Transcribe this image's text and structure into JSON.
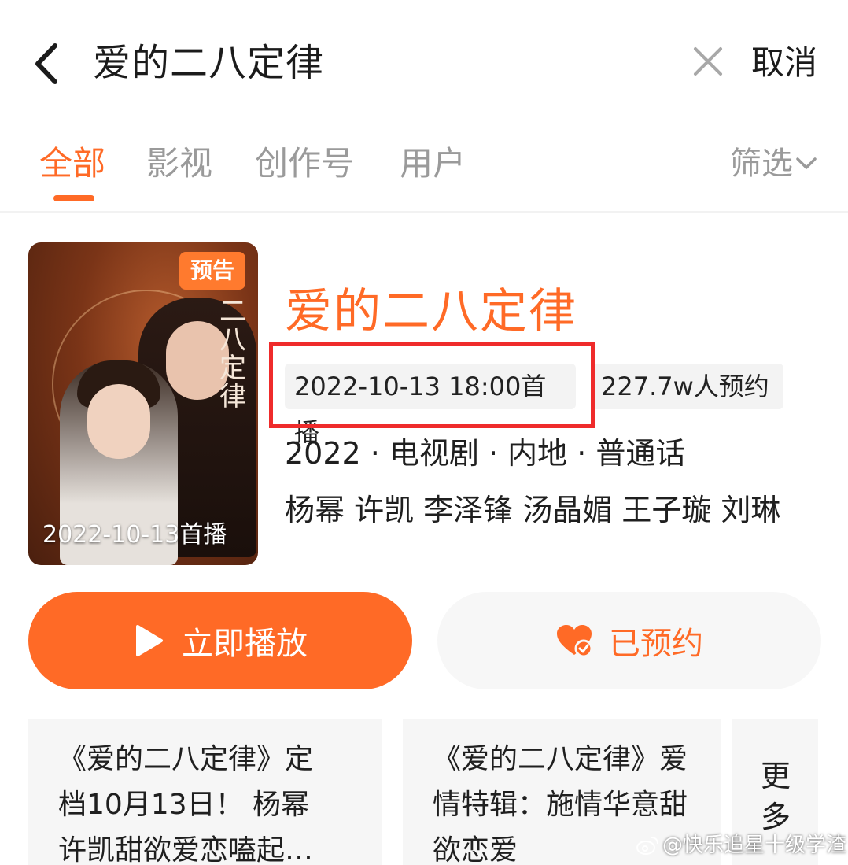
{
  "search": {
    "query": "爱的二八定律",
    "cancel_label": "取消"
  },
  "tabs": [
    {
      "label": "全部",
      "active": true
    },
    {
      "label": "影视",
      "active": false
    },
    {
      "label": "创作号",
      "active": false
    },
    {
      "label": "用户",
      "active": false
    }
  ],
  "filter_label": "筛选",
  "result": {
    "poster": {
      "badge": "预告",
      "date_text": "2022-10-13首播",
      "calligraphy_title": "二八定律"
    },
    "title": "爱的二八定律",
    "premiere": "2022-10-13 18:00首播",
    "reservations": "227.7w人预约",
    "meta": "2022 · 电视剧 · 内地 · 普通话",
    "cast": "杨幂 许凯 李泽锋 汤晶媚 王子璇 刘琳",
    "play_label": "立即播放",
    "reserved_label": "已预约"
  },
  "related": [
    {
      "lines": [
        "《爱的二八定律》定",
        "档10月13日！ 杨幂",
        "许凯甜欲爱恋嗑起…"
      ]
    },
    {
      "lines": [
        "《爱的二八定律》爱",
        "情特辑：施情华意甜",
        "欲恋爱"
      ]
    }
  ],
  "more_label": "更多",
  "watermark": "@快乐追星十级学渣",
  "colors": {
    "accent": "#ff6a26",
    "highlight": "#ef2b2b",
    "muted": "#9a9a9a"
  }
}
